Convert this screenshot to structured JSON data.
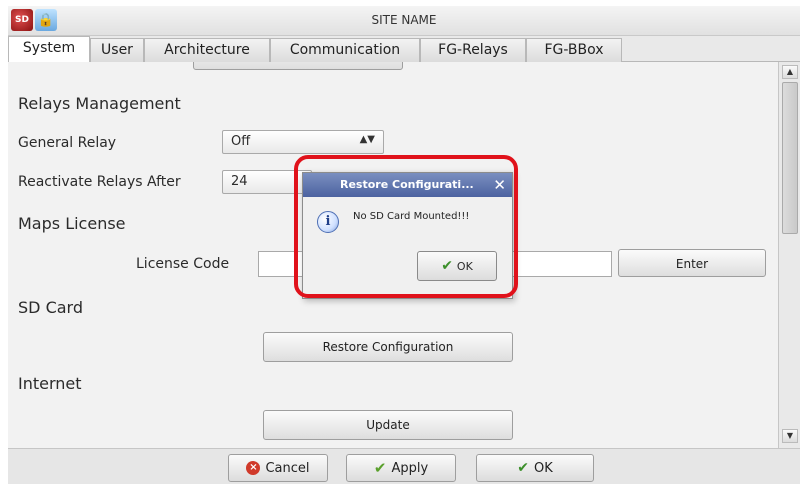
{
  "window": {
    "title": "SITE NAME"
  },
  "app_icons": {
    "first": "SD",
    "second": "🔒"
  },
  "tabs": [
    {
      "label": "System"
    },
    {
      "label": "User"
    },
    {
      "label": "Architecture"
    },
    {
      "label": "Communication"
    },
    {
      "label": "FG-Relays"
    },
    {
      "label": "FG-BBox"
    }
  ],
  "relays": {
    "title": "Relays Management",
    "general_label": "General Relay",
    "general_value": "Off",
    "reactivate_label": "Reactivate Relays After",
    "reactivate_value": "24"
  },
  "maps": {
    "title": "Maps License",
    "license_label": "License Code",
    "license_value": "",
    "enter_button": "Enter"
  },
  "sdcard": {
    "title": "SD Card",
    "restore_button": "Restore Configuration"
  },
  "internet": {
    "title": "Internet",
    "update_button": "Update"
  },
  "bottom": {
    "cancel": "Cancel",
    "apply": "Apply",
    "ok": "OK"
  },
  "dialog": {
    "title": "Restore Configurati...",
    "message": "No SD Card Mounted!!!",
    "ok": "OK"
  },
  "colors": {
    "highlight": "#e0121b",
    "dialog_title_bg": "#5a70aa"
  }
}
